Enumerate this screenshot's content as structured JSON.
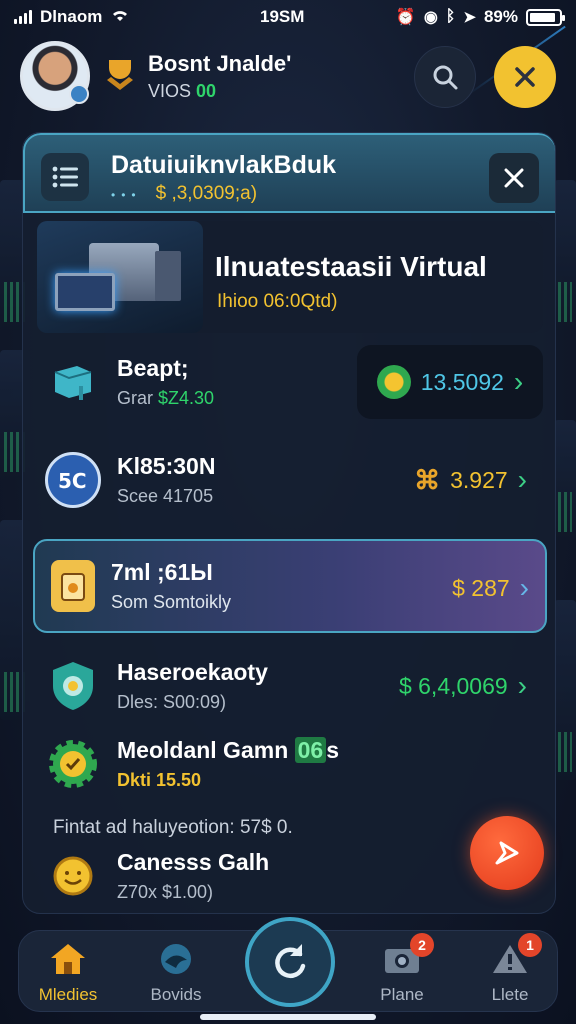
{
  "status_bar": {
    "carrier": "Dlnaom",
    "time": "19SM",
    "battery": "89%",
    "battery_level": 0.89
  },
  "user": {
    "name": "Bosnt Jnalde'",
    "sub_prefix": "VIOS",
    "sub_value": "00"
  },
  "panel_header": {
    "title": "DatuiuiknvlakBduk",
    "subtitle": "$ ,3,0309;a)"
  },
  "feature": {
    "title": "Ilnuatestaasii Virtual",
    "subtitle": "Ihioo 06:0Qtd)"
  },
  "rows": [
    {
      "title": "Beapt;",
      "sub_prefix": "Grar",
      "sub_value": "$Z4.30",
      "amount": "13.5092",
      "icon": "box-icon"
    },
    {
      "title": "Kl85:30N",
      "sub": "Scee 41705",
      "amount": "3.927",
      "icon": "chip-icon"
    },
    {
      "title": "7ml ;61Ы",
      "sub": "Som Somtoikly",
      "amount": "$ 287",
      "icon": "tag-icon"
    },
    {
      "title": "Haseroekaoty",
      "sub": "Dles: S00:09)",
      "amount": "$ 6,4,0069",
      "icon": "shield-icon"
    },
    {
      "title": "Meoldanl Gamn",
      "title_badge": "06",
      "title_suffix": "s",
      "sub": "Dkti 15.50",
      "icon": "gear-icon"
    },
    {
      "title": "Canesss Galh",
      "sub": "Z70x $1.00)",
      "icon": "smiley-coin-icon"
    }
  ],
  "note": "Fintat ad haluyeotion: 57$ 0.",
  "bottom_nav": [
    {
      "label": "Mledies",
      "icon": "home-icon",
      "active": true,
      "badge": ""
    },
    {
      "label": "Bovids",
      "icon": "bird-icon",
      "active": false,
      "badge": ""
    },
    {
      "label": "Plane",
      "icon": "camera-icon",
      "active": false,
      "badge": "2"
    },
    {
      "label": "Llete",
      "icon": "warning-icon",
      "active": false,
      "badge": "1"
    }
  ],
  "colors": {
    "accent_yellow": "#f2c230",
    "accent_green": "#2fd46b",
    "accent_teal": "#4aa5c3",
    "fab_red": "#e33b1c"
  }
}
